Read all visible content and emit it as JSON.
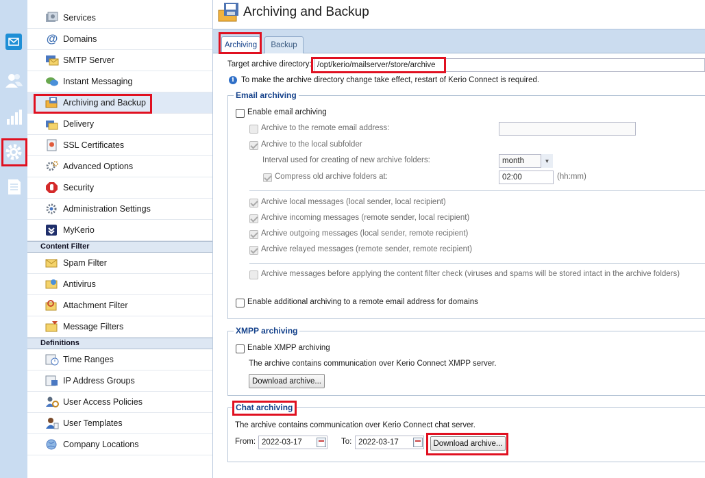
{
  "page": {
    "title": "Archiving and Backup"
  },
  "tabs": [
    {
      "label": "Archiving"
    },
    {
      "label": "Backup"
    }
  ],
  "nav": {
    "items_top": [
      {
        "label": "Services",
        "icon": "services-icon"
      },
      {
        "label": "Domains",
        "icon": "at-sign-icon"
      },
      {
        "label": "SMTP Server",
        "icon": "smtp-server-icon"
      },
      {
        "label": "Instant Messaging",
        "icon": "chat-bubbles-icon"
      },
      {
        "label": "Archiving and Backup",
        "icon": "archive-backup-icon"
      },
      {
        "label": "Delivery",
        "icon": "delivery-icon"
      },
      {
        "label": "SSL Certificates",
        "icon": "certificate-icon"
      },
      {
        "label": "Advanced Options",
        "icon": "gears-icon"
      },
      {
        "label": "Security",
        "icon": "security-stop-icon"
      },
      {
        "label": "Administration Settings",
        "icon": "admin-settings-icon"
      },
      {
        "label": "MyKerio",
        "icon": "mykerio-icon"
      }
    ],
    "section_content_filter": "Content Filter",
    "items_content_filter": [
      {
        "label": "Spam Filter",
        "icon": "spam-filter-icon"
      },
      {
        "label": "Antivirus",
        "icon": "antivirus-icon"
      },
      {
        "label": "Attachment Filter",
        "icon": "attachment-filter-icon"
      },
      {
        "label": "Message Filters",
        "icon": "message-filters-icon"
      }
    ],
    "section_definitions": "Definitions",
    "items_definitions": [
      {
        "label": "Time Ranges",
        "icon": "time-ranges-icon"
      },
      {
        "label": "IP Address Groups",
        "icon": "ip-groups-icon"
      },
      {
        "label": "User Access Policies",
        "icon": "user-policies-icon"
      },
      {
        "label": "User Templates",
        "icon": "user-templates-icon"
      },
      {
        "label": "Company Locations",
        "icon": "company-locations-icon"
      }
    ]
  },
  "archiving": {
    "target_label": "Target archive directory:",
    "target_value": "/opt/kerio/mailserver/store/archive",
    "info_text": "To make the archive directory change take effect, restart of Kerio Connect is required.",
    "email": {
      "legend": "Email archiving",
      "enable_label": "Enable email archiving",
      "remote_label": "Archive to the remote email address:",
      "remote_value": "",
      "local_label": "Archive to the local subfolder",
      "interval_label": "Interval used for creating of new archive folders:",
      "interval_value": "month",
      "compress_label": "Compress old archive folders at:",
      "compress_value": "02:00",
      "compress_unit": "(hh:mm)",
      "local_msgs": "Archive local messages (local sender, local recipient)",
      "incoming_msgs": "Archive incoming messages (remote sender, local recipient)",
      "outgoing_msgs": "Archive outgoing messages (local sender, remote recipient)",
      "relayed_msgs": "Archive relayed messages (remote sender, remote recipient)",
      "before_filter": "Archive messages before applying the content filter check (viruses and spams will be stored intact in the archive folders)",
      "additional_label": "Enable additional archiving to a remote email address for domains"
    },
    "xmpp": {
      "legend": "XMPP archiving",
      "enable_label": "Enable XMPP archiving",
      "desc": "The archive contains communication over Kerio Connect XMPP server.",
      "download_label": "Download archive..."
    },
    "chat": {
      "legend": "Chat archiving",
      "desc": "The archive contains communication over Kerio Connect chat server.",
      "from_label": "From:",
      "from_value": "2022-03-17",
      "to_label": "To:",
      "to_value": "2022-03-17",
      "download_label": "Download archive..."
    }
  }
}
